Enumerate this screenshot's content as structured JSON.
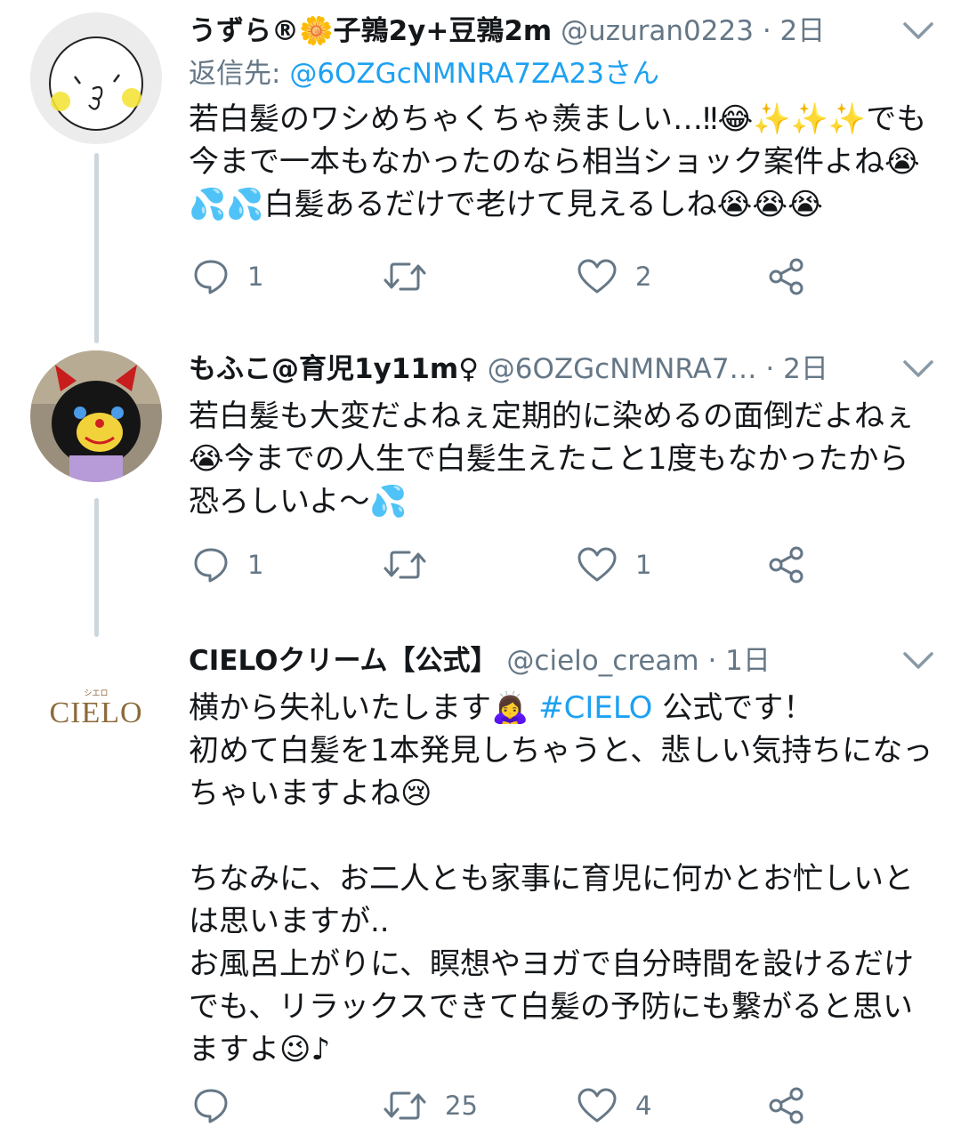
{
  "colors": {
    "accent": "#1da1f2",
    "muted": "#657786",
    "text": "#14171a",
    "thread_line": "#ccd6dd"
  },
  "tweets": [
    {
      "display_name": "うずら®🌼子鶉2y+豆鶉2m",
      "handle": "@uzuran0223",
      "separator": "·",
      "time": "2日",
      "reply_to_label": "返信先: ",
      "reply_to_handle": "@6OZGcNMNRA7ZA23さん",
      "body": "若白髪のワシめちゃくちゃ羨ましい…‼😂✨✨✨でも今まで一本もなかったのなら相当ショック案件よね😭💦💦白髪あるだけで老けて見えるしね😭😭😭",
      "reply_count": "1",
      "retweet_count": "",
      "like_count": "2",
      "avatar_icon": "bird-face-icon"
    },
    {
      "display_name": "もふこ@育児1y11m♀",
      "handle": "@6OZGcNMNRA7…",
      "separator": "·",
      "time": "2日",
      "body": "若白髪も大変だよねぇ定期的に染めるの面倒だよねぇ😭今までの人生で白髪生えたこと1度もなかったから恐ろしいよ〜💦",
      "reply_count": "1",
      "retweet_count": "",
      "like_count": "1",
      "avatar_icon": "black-cat-plush-icon"
    },
    {
      "display_name": "CIELOクリーム【公式】",
      "handle": "@cielo_cream",
      "separator": "·",
      "time": "1日",
      "body_line1_pre": "横から失礼いたします🙇‍♀️ ",
      "hashtag": "#CIELO",
      "body_line1_post": " 公式です！",
      "body_rest": "初めて白髪を1本発見しちゃうと、悲しい気持ちになっちゃいますよね😢\n\nちなみに、お二人とも家事に育児に何かとお忙しいとは思いますが..\nお風呂上がりに、瞑想やヨガで自分時間を設けるだけでも、リラックスできて白髪の予防にも繋がると思いますよ😉♪",
      "reply_count": "",
      "retweet_count": "25",
      "like_count": "4",
      "avatar_logo_small": "シエロ",
      "avatar_logo": "CIELO",
      "avatar_icon": "cielo-logo"
    }
  ]
}
